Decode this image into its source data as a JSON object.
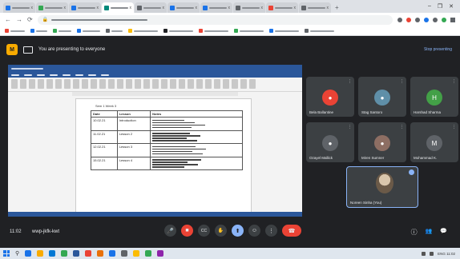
{
  "browser": {
    "tabs": [
      {
        "label": "x",
        "color": "#1a73e8"
      },
      {
        "label": "x",
        "color": "#34a853"
      },
      {
        "label": "x",
        "color": "#1a73e8"
      },
      {
        "label": "x",
        "color": "#00897b",
        "active": true
      },
      {
        "label": "x",
        "color": "#5f6368"
      },
      {
        "label": "x",
        "color": "#1a73e8"
      },
      {
        "label": "x",
        "color": "#1a73e8"
      },
      {
        "label": "x",
        "color": "#5f6368"
      },
      {
        "label": "x",
        "color": "#ea4335"
      },
      {
        "label": "x",
        "color": "#5f6368"
      }
    ],
    "new_tab": "+",
    "window_controls": [
      "–",
      "❐",
      "✕"
    ]
  },
  "meet": {
    "presenting_label": "You are presenting to everyone",
    "stop_presenting": "Stop presenting",
    "meeting_time": "11:02",
    "meeting_code": "wwp-jkfk-kwt"
  },
  "doc": {
    "header": "Sem 1 Week 3",
    "columns": [
      "Date",
      "Lesson",
      "Notes"
    ],
    "rows": [
      {
        "date": "10.02.21",
        "lesson": "Introduction"
      },
      {
        "date": "11.02.21",
        "lesson": "Lesson 2"
      },
      {
        "date": "12.02.21",
        "lesson": "Lesson 3"
      },
      {
        "date": "15.02.21",
        "lesson": "Lesson 4"
      }
    ]
  },
  "participants": [
    {
      "name": "Bela Ballantine",
      "avatar_color": "#ea4335",
      "initial": "●"
    },
    {
      "name": "Stag Santoro",
      "avatar_color": "#5f8fa8",
      "initial": "●"
    },
    {
      "name": "Harshad Sharma",
      "avatar_color": "#43a047",
      "initial": "H"
    },
    {
      "name": "Ozayel Mallick",
      "avatar_color": "#5f6368",
      "initial": "●"
    },
    {
      "name": "Miren Sumner",
      "avatar_color": "#8d6e63",
      "initial": "●"
    },
    {
      "name": "Mohammad K.",
      "avatar_color": "#5f6368",
      "initial": "M"
    }
  ],
  "self_tile": {
    "name": "Noreen Sinha (You)"
  },
  "controls": {
    "mic": "🎤",
    "cam": "■",
    "captions": "CC",
    "present": "⬆",
    "raise_hand": "✋",
    "more": "⋮",
    "end_call": "☎"
  },
  "right_controls": {
    "info": "ⓘ",
    "people": "👥",
    "chat": "💬"
  },
  "taskbar": {
    "icons": [
      "#1a73e8",
      "#f9ab00",
      "#0078d4",
      "#34a853",
      "#2b579a",
      "#ea4335",
      "#e8710a",
      "#1a73e8",
      "#5f6368",
      "#fbbc04",
      "#34a853",
      "#8e24aa"
    ],
    "tray_text": "ENG 11:02"
  }
}
